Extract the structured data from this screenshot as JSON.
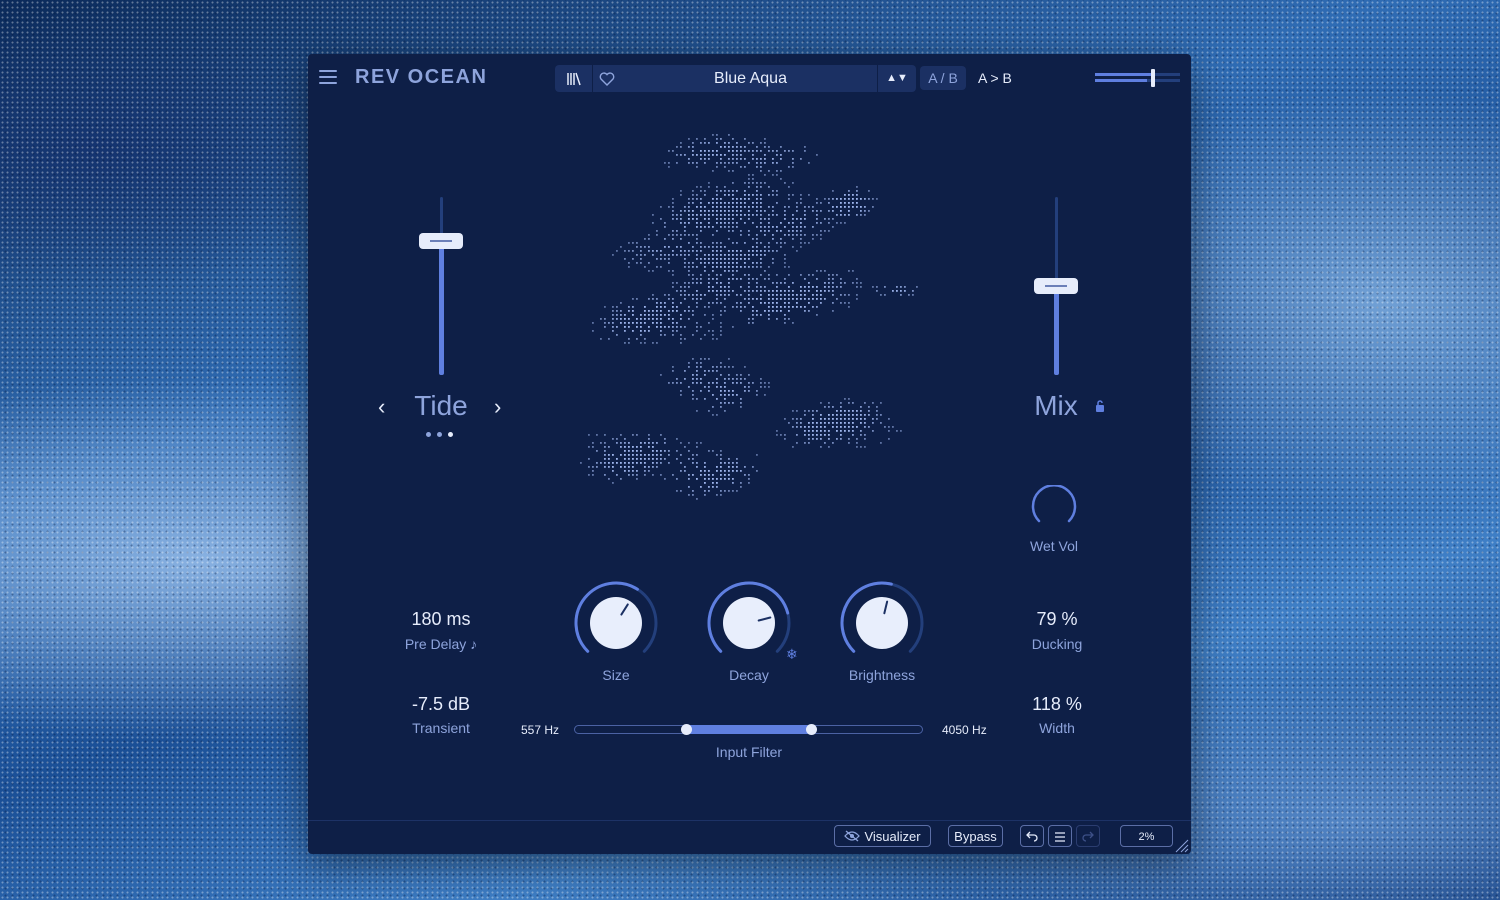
{
  "header": {
    "title": "REV OCEAN",
    "preset_name": "Blue Aqua",
    "preset_nav": "▲▼",
    "ab_toggle": "A / B",
    "ab_copy": "A > B",
    "output_level": 0.68
  },
  "tide": {
    "label": "Tide",
    "prev": "‹",
    "next": "›",
    "fader_level": 0.78,
    "page_dots": 3,
    "active_dot": 2
  },
  "mix": {
    "label": "Mix",
    "fader_level": 0.5
  },
  "wet_vol": {
    "label": "Wet Vol"
  },
  "knobs": {
    "size": {
      "label": "Size",
      "value": 0.62
    },
    "decay": {
      "label": "Decay",
      "value": 0.78
    },
    "brightness": {
      "label": "Brightness",
      "value": 0.55
    }
  },
  "params": {
    "pre_delay": {
      "value": "180 ms",
      "label": "Pre Delay"
    },
    "transient": {
      "value": "-7.5 dB",
      "label": "Transient"
    },
    "ducking": {
      "value": "79 %",
      "label": "Ducking"
    },
    "width": {
      "value": "118 %",
      "label": "Width"
    }
  },
  "input_filter": {
    "label": "Input Filter",
    "low": "557 Hz",
    "high": "4050 Hz",
    "low_pos": 0.32,
    "high_pos": 0.68
  },
  "footer": {
    "visualizer": "Visualizer",
    "bypass": "Bypass",
    "cpu": "2%"
  },
  "colors": {
    "panel": "#0e1f47",
    "accent": "#5f7fe0",
    "text_light": "#e6ecfb",
    "text_muted": "#8ea4dc"
  }
}
